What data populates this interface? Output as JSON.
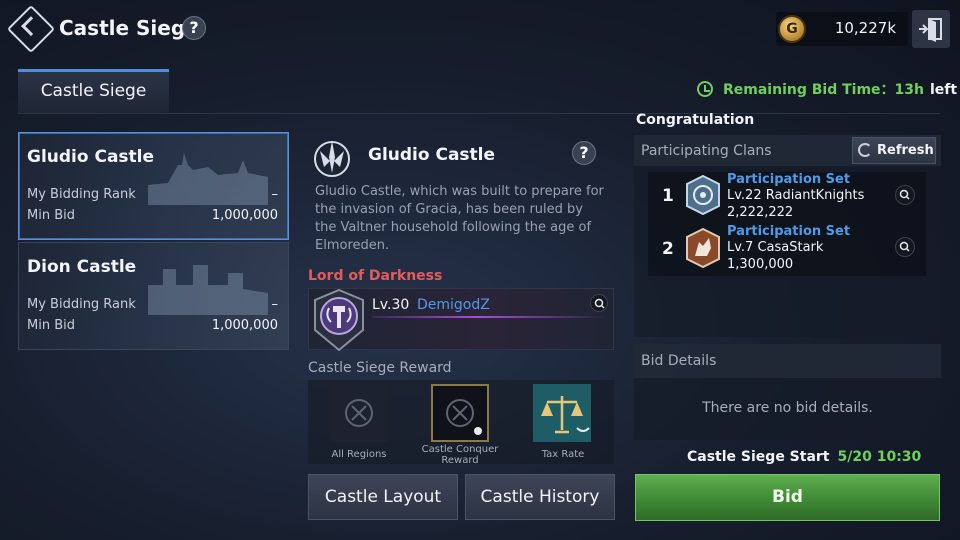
{
  "header": {
    "title": "Castle Siege",
    "currency_icon_letter": "G",
    "currency_amount": "10,227k"
  },
  "tabs": [
    {
      "label": "Castle Siege",
      "active": true
    }
  ],
  "bid_time": {
    "label": "Remaining Bid Time：13h",
    "suffix": "left"
  },
  "castles": [
    {
      "name": "Gludio Castle",
      "selected": true,
      "bidding_rank_label": "My Bidding Rank",
      "bidding_rank_value": "–",
      "min_bid_label": "Min Bid",
      "min_bid_value": "1,000,000"
    },
    {
      "name": "Dion Castle",
      "selected": false,
      "bidding_rank_label": "My Bidding Rank",
      "bidding_rank_value": "–",
      "min_bid_label": "Min Bid",
      "min_bid_value": "1,000,000"
    }
  ],
  "info": {
    "castle_name": "Gludio Castle",
    "description": "Gludio Castle, which was built to prepare for the invasion of Gracia, has been ruled by the Valtner household following the age of Elmoreden."
  },
  "lord": {
    "title": "Lord of Darkness",
    "level": "Lv.30",
    "name": "DemigodZ"
  },
  "reward": {
    "title": "Castle Siege Reward",
    "items": [
      {
        "label": "All Regions",
        "icon": "locked-circle-icon"
      },
      {
        "label": "Castle Conquer Reward",
        "icon": "locked-circle-icon"
      },
      {
        "label": "Tax Rate",
        "icon": "scales-icon"
      }
    ]
  },
  "buttons": {
    "castle_layout": "Castle Layout",
    "castle_history": "Castle History",
    "refresh": "Refresh",
    "bid": "Bid"
  },
  "congratulation": "Congratulation",
  "clans": {
    "title": "Participating Clans",
    "list": [
      {
        "rank": "1",
        "set": "Participation Set",
        "name": "Lv.22 RadiantKnights",
        "value": "2,222,222",
        "color": "#4b6f8c"
      },
      {
        "rank": "2",
        "set": "Participation Set",
        "name": "Lv.7 CasaStark",
        "value": "1,300,000",
        "color": "#8a4a2a"
      }
    ]
  },
  "bid_details": {
    "title": "Bid Details",
    "empty": "There are no bid details."
  },
  "siege_start": {
    "label": "Castle Siege Start",
    "date": "5/20 10:30"
  },
  "colors": {
    "accent_green": "#6fd15a",
    "accent_blue": "#4f9be8",
    "lord_red": "#e35b5b"
  }
}
